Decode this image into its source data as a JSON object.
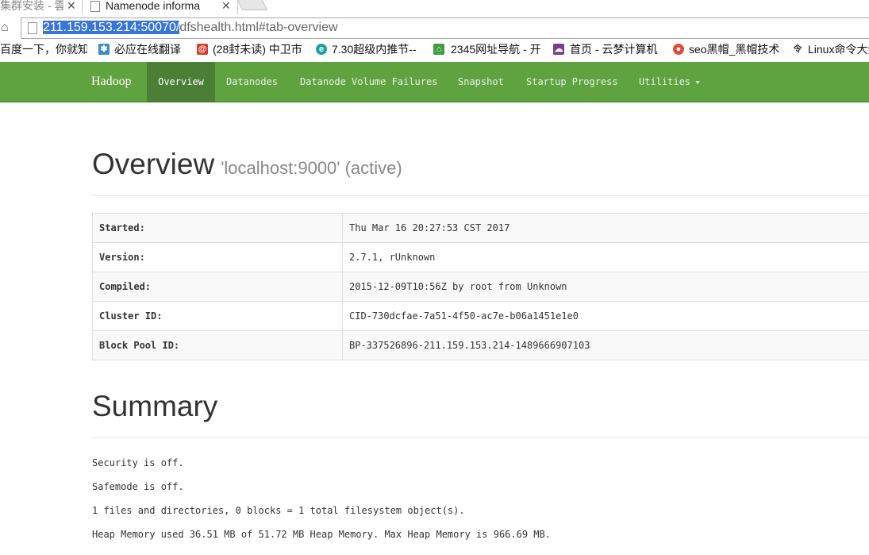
{
  "browser": {
    "tabs": [
      {
        "label": "集群安装 - 雲"
      },
      {
        "label": "Namenode informa"
      }
    ],
    "address": {
      "host": "211.159.153.214:50070/",
      "path": "dfshealth.html#tab-overview"
    },
    "bookmarks": [
      {
        "label": "百度一下，你就知",
        "icon": "baidu-icon",
        "color": "#2d6ad6"
      },
      {
        "label": "必应在线翻译",
        "icon": "bing-translate-icon",
        "color": "#3a8cc1"
      },
      {
        "label": "(28封未读) 中卫市",
        "icon": "mail-icon",
        "color": "#d83b2b"
      },
      {
        "label": "7.30超级内推节--",
        "icon": "event-icon",
        "color": "#19a1a1"
      },
      {
        "label": "2345网址导航 - 开",
        "icon": "nav2345-icon",
        "color": "#3f9d3f"
      },
      {
        "label": "首页 - 云梦计算机",
        "icon": "cloud-icon",
        "color": "#7a3d8c"
      },
      {
        "label": "seo黑帽_黑帽技术",
        "icon": "chrome-icon",
        "color": "#e24a3b"
      },
      {
        "label": "Linux命令大全",
        "icon": "linux-icon",
        "color": "#333333"
      }
    ]
  },
  "nav": {
    "brand": "Hadoop",
    "items": [
      {
        "label": "Overview",
        "active": true
      },
      {
        "label": "Datanodes"
      },
      {
        "label": "Datanode Volume Failures"
      },
      {
        "label": "Snapshot"
      },
      {
        "label": "Startup Progress"
      },
      {
        "label": "Utilities"
      }
    ],
    "color": "#5fa341",
    "active_color": "#4b7f36"
  },
  "overview": {
    "title": "Overview",
    "subtitle": "'localhost:9000' (active)",
    "rows": [
      {
        "key": "Started:",
        "value": "Thu Mar 16 20:27:53 CST 2017"
      },
      {
        "key": "Version:",
        "value": "2.7.1, rUnknown"
      },
      {
        "key": "Compiled:",
        "value": "2015-12-09T10:56Z by root from Unknown"
      },
      {
        "key": "Cluster ID:",
        "value": "CID-730dcfae-7a51-4f50-ac7e-b06a1451e1e0"
      },
      {
        "key": "Block Pool ID:",
        "value": "BP-337526896-211.159.153.214-1489666907103"
      }
    ]
  },
  "summary": {
    "title": "Summary",
    "lines": [
      "Security is off.",
      "Safemode is off.",
      "1 files and directories, 0 blocks = 1 total filesystem object(s).",
      "Heap Memory used 36.51 MB of 51.72 MB Heap Memory. Max Heap Memory is 966.69 MB."
    ]
  }
}
